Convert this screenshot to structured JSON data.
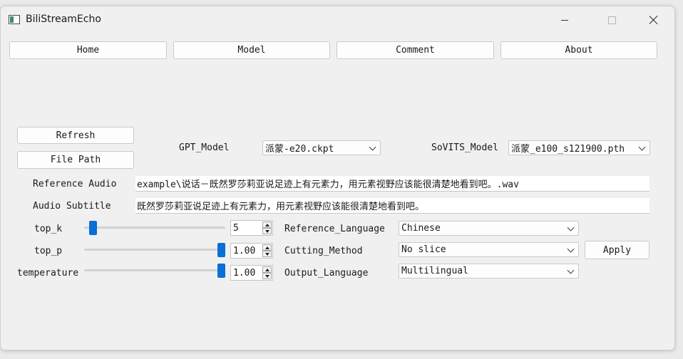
{
  "window": {
    "title": "BiliStreamEcho"
  },
  "nav": {
    "home": "Home",
    "model": "Model",
    "comment": "Comment",
    "about": "About"
  },
  "buttons": {
    "refresh": "Refresh",
    "file_path": "File Path",
    "apply": "Apply"
  },
  "models": {
    "gpt_label": "GPT_Model",
    "gpt_value": "派蒙-e20.ckpt",
    "sovits_label": "SoVITS_Model",
    "sovits_value": "派蒙_e100_s121900.pth"
  },
  "reference": {
    "audio_label": "Reference Audio",
    "audio_value": "example\\说话－既然罗莎莉亚说足迹上有元素力，用元素视野应该能很清楚地看到吧。.wav",
    "subtitle_label": "Audio Subtitle",
    "subtitle_value": "既然罗莎莉亚说足迹上有元素力，用元素视野应该能很清楚地看到吧。"
  },
  "params": {
    "top_k": {
      "label": "top_k",
      "value": "5",
      "level": 0.04
    },
    "top_p": {
      "label": "top_p",
      "value": "1.00",
      "level": 1.0
    },
    "temperature": {
      "label": "temperature",
      "value": "1.00",
      "level": 1.0
    }
  },
  "options": {
    "ref_lang_label": "Reference_Language",
    "ref_lang_value": "Chinese",
    "cut_label": "Cutting_Method",
    "cut_value": "No slice",
    "out_lang_label": "Output_Language",
    "out_lang_value": "Multilingual"
  },
  "colors": {
    "accent": "#0a6fd6",
    "window_bg": "#f0f0f0"
  }
}
